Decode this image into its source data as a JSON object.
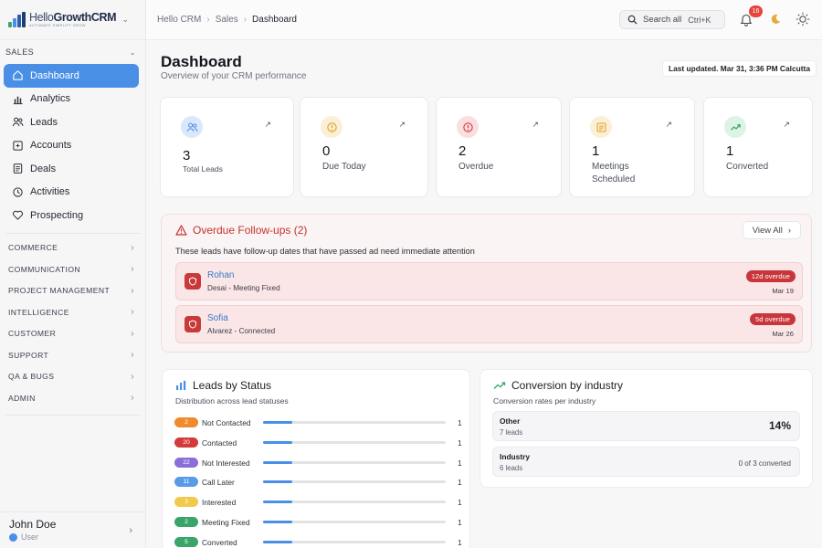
{
  "app": {
    "logo_main": "Growth",
    "logo_prefix": "Hello",
    "logo_suffix": "CRM",
    "logo_tagline": "AUTOMATE SIMPLIFY GROW"
  },
  "sidebar": {
    "section_label": "SALES",
    "items": [
      {
        "label": "Dashboard",
        "icon": "home-icon",
        "active": true
      },
      {
        "label": "Analytics",
        "icon": "bar-chart-icon"
      },
      {
        "label": "Leads",
        "icon": "users-icon"
      },
      {
        "label": "Accounts",
        "icon": "building-icon"
      },
      {
        "label": "Deals",
        "icon": "document-icon"
      },
      {
        "label": "Activities",
        "icon": "clock-icon"
      },
      {
        "label": "Prospecting",
        "icon": "heart-icon"
      }
    ],
    "groups": [
      "COMMERCE",
      "COMMUNICATION",
      "PROJECT MANAGEMENT",
      "INTELLIGENCE",
      "CUSTOMER",
      "SUPPORT",
      "QA & BUGS",
      "ADMIN"
    ],
    "user": {
      "name": "John Doe",
      "role": "User"
    }
  },
  "topbar": {
    "breadcrumbs": [
      "Hello CRM",
      "Sales",
      "Dashboard"
    ],
    "search_label": "Search all",
    "search_shortcut": "Ctrl+K",
    "notification_count": "16"
  },
  "header": {
    "title": "Dashboard",
    "subtitle": "Overview of your CRM performance",
    "last_updated": "Last updated. Mar 31, 3:36 PM Calcutta"
  },
  "stats": [
    {
      "value": "3",
      "label": "Total Leads",
      "icon": "users-icon",
      "color": "#dbe8fb"
    },
    {
      "value": "0",
      "label": "Due Today",
      "icon": "alert-circle-icon",
      "color": "#fbefd6"
    },
    {
      "value": "2",
      "label": "Overdue",
      "icon": "alert-circle-icon",
      "color": "#fbdfe0"
    },
    {
      "value": "1",
      "label": "Meetings Scheduled",
      "icon": "calendar-icon",
      "color": "#fbefd6"
    },
    {
      "value": "1",
      "label": "Converted",
      "icon": "trending-up-icon",
      "color": "#dcf3e6"
    }
  ],
  "overdue": {
    "title": "Overdue Follow-ups (2)",
    "view_all": "View All",
    "description": "These leads have follow-up dates that have passed ad need immediate attention",
    "items": [
      {
        "name": "Rohan",
        "detail": "Desai - Meeting Fixed",
        "badge": "12d overdue",
        "date": "Mar 19"
      },
      {
        "name": "Sofia",
        "detail": "Alvarez - Connected",
        "badge": "5d overdue",
        "date": "Mar 26"
      }
    ]
  },
  "leads_by_status": {
    "title": "Leads by Status",
    "subtitle": "Distribution across lead statuses",
    "rows": [
      {
        "code": "2",
        "label": "Not Contacted",
        "count": "1",
        "color": "#ef8a2e",
        "fraction": 0.16
      },
      {
        "code": "20",
        "label": "Contacted",
        "count": "1",
        "color": "#d43a3a",
        "fraction": 0.16
      },
      {
        "code": "22",
        "label": "Not Interested",
        "count": "1",
        "color": "#8a6fd8",
        "fraction": 0.16
      },
      {
        "code": "11",
        "label": "Call Later",
        "count": "1",
        "color": "#5a9be8",
        "fraction": 0.16
      },
      {
        "code": "3",
        "label": "Interested",
        "count": "1",
        "color": "#f2c94c",
        "fraction": 0.16
      },
      {
        "code": "2",
        "label": "Meeting Fixed",
        "count": "1",
        "color": "#3aa568",
        "fraction": 0.16
      },
      {
        "code": "5",
        "label": "Converted",
        "count": "1",
        "color": "#3aa568",
        "fraction": 0.16
      }
    ]
  },
  "conversion": {
    "title": "Conversion by industry",
    "subtitle": "Conversion rates per industry",
    "rows": [
      {
        "name": "Other",
        "leads": "7 leads",
        "rate": "14%",
        "converted": ""
      },
      {
        "name": "Industry",
        "leads": "6 leads",
        "rate": "",
        "converted": "0 of 3 converted"
      }
    ]
  }
}
